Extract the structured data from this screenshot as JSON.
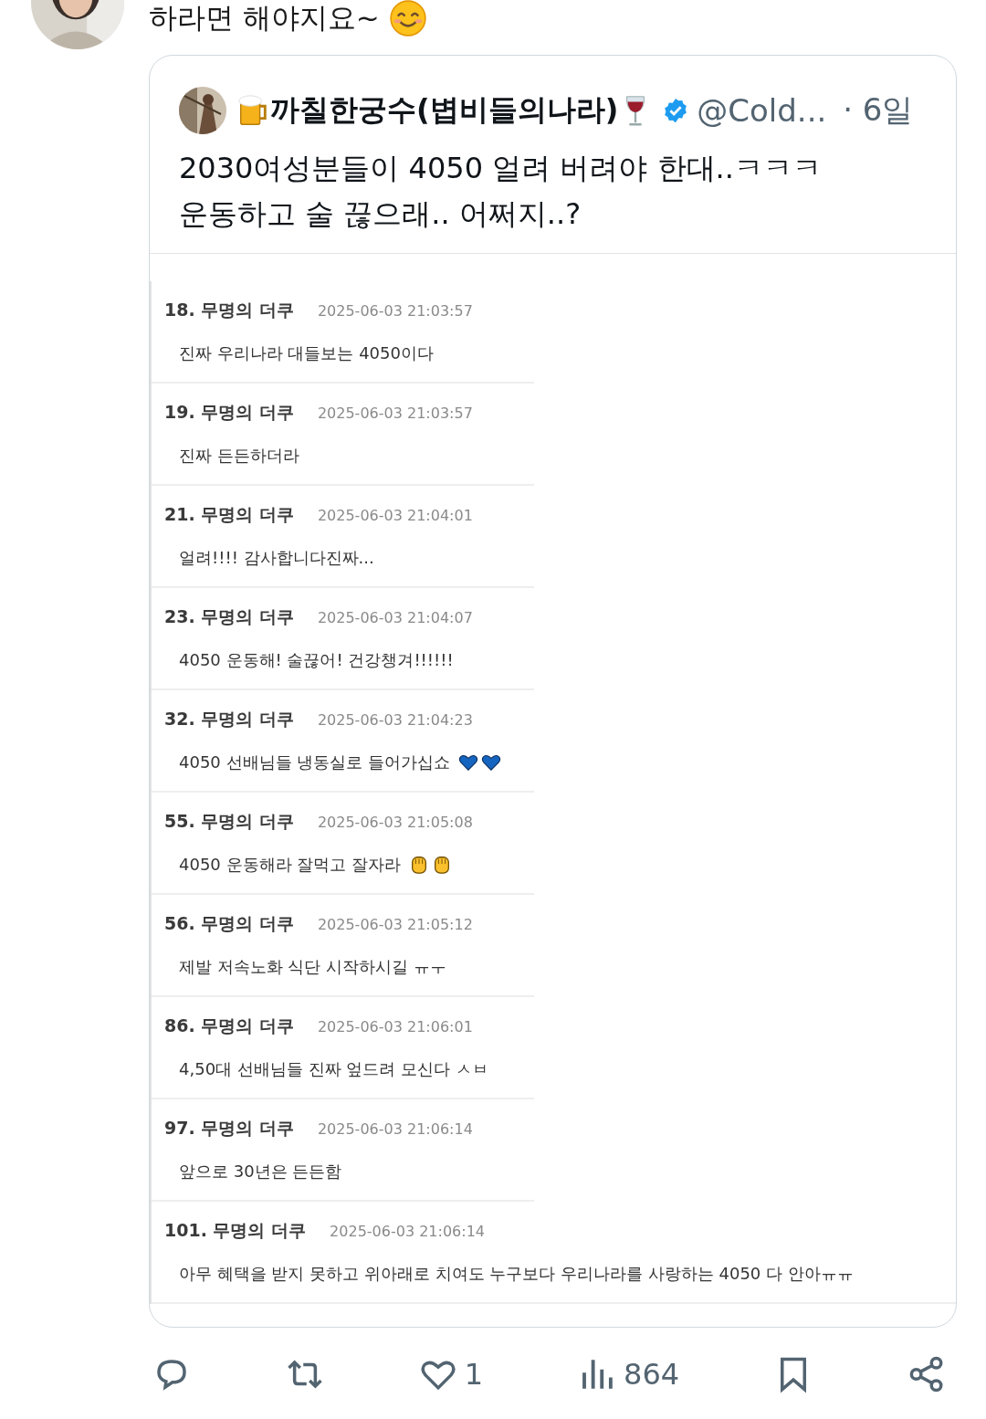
{
  "tweet": {
    "text": "하라면 해야지요~"
  },
  "quote": {
    "name": "까칠한궁수(볍비들의나라)",
    "verified": true,
    "handle": "@Cold...",
    "time": "· 6일",
    "lines": [
      "2030여성분들이 4050 얼려 버려야 한대..ㅋㅋㅋ",
      "운동하고 술 끊으래.. 어쩌지..?"
    ],
    "comments": [
      {
        "number": "18.",
        "author": "무명의 더쿠",
        "date": "2025-06-03 21:03:57",
        "text": "진짜 우리나라 대들보는 4050이다"
      },
      {
        "number": "19.",
        "author": "무명의 더쿠",
        "date": "2025-06-03 21:03:57",
        "text": "진짜 든든하더라"
      },
      {
        "number": "21.",
        "author": "무명의 더쿠",
        "date": "2025-06-03 21:04:01",
        "text": "얼려!!!! 감사합니다진짜..."
      },
      {
        "number": "23.",
        "author": "무명의 더쿠",
        "date": "2025-06-03 21:04:07",
        "text": "4050 운동해! 술끊어! 건강챙겨!!!!!!"
      },
      {
        "number": "32.",
        "author": "무명의 더쿠",
        "date": "2025-06-03 21:04:23",
        "text": "4050 선배님들 냉동실로 들어가십쇼",
        "emoji": [
          {
            "kind": "heart"
          },
          {
            "kind": "heart"
          }
        ]
      },
      {
        "number": "55.",
        "author": "무명의 더쿠",
        "date": "2025-06-03 21:05:08",
        "text": "4050 운동해라 잘먹고 잘자라",
        "emoji": [
          {
            "kind": "fist"
          },
          {
            "kind": "fist"
          }
        ]
      },
      {
        "number": "56.",
        "author": "무명의 더쿠",
        "date": "2025-06-03 21:05:12",
        "text": "제발 저속노화 식단 시작하시길 ㅠㅜ"
      },
      {
        "number": "86.",
        "author": "무명의 더쿠",
        "date": "2025-06-03 21:06:01",
        "text": "4,50대 선배님들 진짜 엎드려 모신다 ㅅㅂ"
      },
      {
        "number": "97.",
        "author": "무명의 더쿠",
        "date": "2025-06-03 21:06:14",
        "text": "앞으로 30년은 든든함"
      },
      {
        "number": "101.",
        "author": "무명의 더쿠",
        "date": "2025-06-03 21:06:14",
        "text": "아무 혜택을 받지 못하고 위아래로 치여도 누구보다 우리나라를 사랑하는 4050 다 안아ㅠㅠ"
      }
    ]
  },
  "actions": [
    {
      "kind": "reply"
    },
    {
      "kind": "repost"
    },
    {
      "kind": "like",
      "count": "1"
    },
    {
      "kind": "views",
      "count": "864"
    },
    {
      "kind": "bookmark"
    },
    {
      "kind": "share"
    }
  ]
}
